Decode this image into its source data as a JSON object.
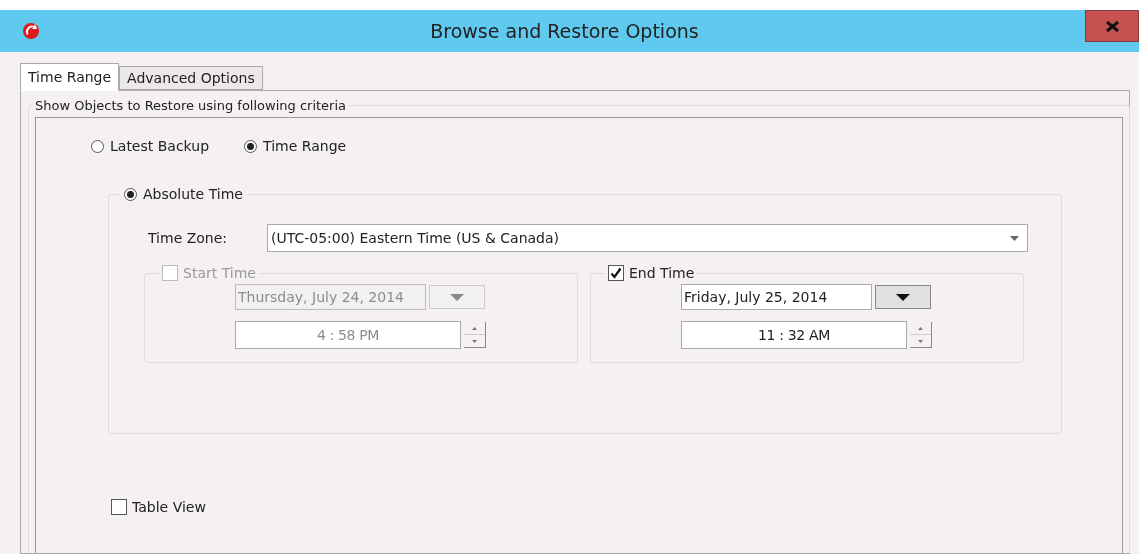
{
  "window": {
    "title": "Browse and Restore Options"
  },
  "tabs": [
    {
      "label": "Time Range",
      "selected": true
    },
    {
      "label": "Advanced Options",
      "selected": false
    }
  ],
  "criteria": {
    "legend": "Show Objects to Restore using following criteria",
    "mode_options": [
      {
        "label": "Latest Backup",
        "selected": false
      },
      {
        "label": "Time Range",
        "selected": true
      }
    ],
    "absolute_time": {
      "label": "Absolute Time",
      "selected": true,
      "time_zone": {
        "label": "Time Zone:",
        "value": "(UTC-05:00) Eastern Time (US & Canada)"
      },
      "ranges": [
        {
          "label": "Start Time",
          "checked": false,
          "date": "Thursday, July 24, 2014",
          "time": "4 : 58 PM"
        },
        {
          "label": "End Time",
          "checked": true,
          "date": "Friday, July 25, 2014",
          "time": "11 : 32 AM"
        }
      ]
    },
    "table_view": {
      "label": "Table View",
      "checked": false
    }
  }
}
